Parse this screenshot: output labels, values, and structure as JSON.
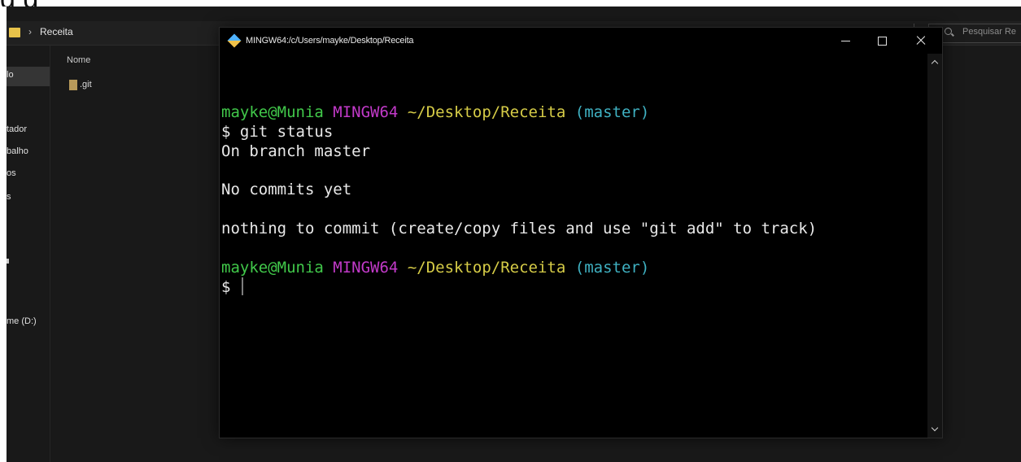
{
  "top_strip": {
    "text": "g g"
  },
  "explorer": {
    "breadcrumb": {
      "separator": "›",
      "current": "Receita"
    },
    "search": {
      "placeholder": "Pesquisar Re"
    },
    "sidebar": {
      "items": [
        {
          "label": "lo"
        },
        {
          "label": "tador"
        },
        {
          "label": "balho"
        },
        {
          "label": "os"
        },
        {
          "label": "s"
        },
        {
          "label": "me (D:)"
        }
      ]
    },
    "column_header": "Nome",
    "files": [
      {
        "name": ".git",
        "icon": "folder-icon"
      }
    ],
    "colors": {
      "background": "#191919",
      "folder": "#e8c34a"
    }
  },
  "terminal": {
    "title": "MINGW64:/c/Users/mayke/Desktop/Receita",
    "controls": {
      "minimize": "minimize-icon",
      "maximize": "maximize-icon",
      "close": "close-icon"
    },
    "prompt": {
      "user_host": "mayke@Munia",
      "system": "MINGW64",
      "path": "~/Desktop/Receita",
      "branch": "(master)",
      "symbol": "$"
    },
    "lines": {
      "command": "$ git status",
      "out1": "On branch master",
      "out2": "No commits yet",
      "out3": "nothing to commit (create/copy files and use \"git add\" to track)",
      "final_prompt_symbol": "$"
    },
    "colors": {
      "user_host": "#41c84a",
      "system": "#c23ac9",
      "path": "#d6cc47",
      "branch": "#3fb1c2",
      "text": "#e9e9e9",
      "background": "#000000"
    }
  }
}
